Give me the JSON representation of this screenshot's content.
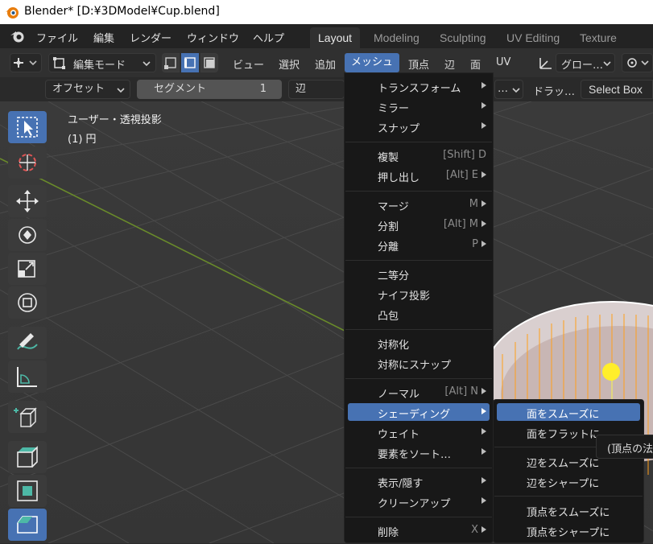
{
  "window": {
    "title": "Blender* [D:¥3DModel¥Cup.blend]"
  },
  "topmenu": {
    "items": [
      "ファイル",
      "編集",
      "レンダー",
      "ウィンドウ",
      "ヘルプ"
    ]
  },
  "workspaces": {
    "tabs": [
      "Layout",
      "Modeling",
      "Sculpting",
      "UV Editing",
      "Texture Paint"
    ],
    "active": "Layout"
  },
  "header": {
    "mode": "編集モード",
    "menus": [
      "ビュー",
      "選択",
      "追加",
      "メッシュ",
      "頂点",
      "辺",
      "面",
      "UV"
    ],
    "active_menu": "メッシュ",
    "transform": "グロー…"
  },
  "toolsettings": {
    "offset": "オフセット",
    "segments_label": "セグメント",
    "segments_value": "1",
    "edge_select": "辺",
    "ellipsis": "…",
    "drag_label": "ドラッ…",
    "drag_value": "Select Box"
  },
  "viewport": {
    "view_name": "ユーザー・透視投影",
    "object_name": "(1) 円"
  },
  "mesh_menu": {
    "items": [
      {
        "label": "トランスフォーム",
        "shortcut": "",
        "submenu": true
      },
      {
        "label": "ミラー",
        "shortcut": "",
        "submenu": true
      },
      {
        "label": "スナップ",
        "shortcut": "",
        "submenu": true
      },
      {
        "label": "複製",
        "shortcut": "[Shift] D",
        "submenu": false
      },
      {
        "label": "押し出し",
        "shortcut": "[Alt] E",
        "submenu": true
      },
      {
        "label": "マージ",
        "shortcut": "M",
        "submenu": true
      },
      {
        "label": "分割",
        "shortcut": "[Alt] M",
        "submenu": true
      },
      {
        "label": "分離",
        "shortcut": "P",
        "submenu": true
      },
      {
        "label": "二等分",
        "shortcut": "",
        "submenu": false
      },
      {
        "label": "ナイフ投影",
        "shortcut": "",
        "submenu": false
      },
      {
        "label": "凸包",
        "shortcut": "",
        "submenu": false
      },
      {
        "label": "対称化",
        "shortcut": "",
        "submenu": false
      },
      {
        "label": "対称にスナップ",
        "shortcut": "",
        "submenu": false
      },
      {
        "label": "ノーマル",
        "shortcut": "[Alt] N",
        "submenu": true
      },
      {
        "label": "シェーディング",
        "shortcut": "",
        "submenu": true
      },
      {
        "label": "ウェイト",
        "shortcut": "",
        "submenu": true
      },
      {
        "label": "要素をソート…",
        "shortcut": "",
        "submenu": true
      },
      {
        "label": "表示/隠す",
        "shortcut": "",
        "submenu": true
      },
      {
        "label": "クリーンアップ",
        "shortcut": "",
        "submenu": true
      },
      {
        "label": "削除",
        "shortcut": "X",
        "submenu": true
      }
    ],
    "highlighted": "シェーディング"
  },
  "shading_submenu": {
    "items": [
      "面をスムーズに",
      "面をフラットに",
      "辺をスムーズに",
      "辺をシャープに",
      "頂点をスムーズに",
      "頂点をシャープに"
    ],
    "highlighted": "面をスムーズに"
  },
  "tooltip": {
    "text": "(頂点の法"
  },
  "colors": {
    "accent": "#4772b3",
    "menu_bg": "#181818",
    "viewport_bg": "#393939",
    "mesh_edge": "#ff9f1a",
    "pivot": "#ffee2a"
  }
}
